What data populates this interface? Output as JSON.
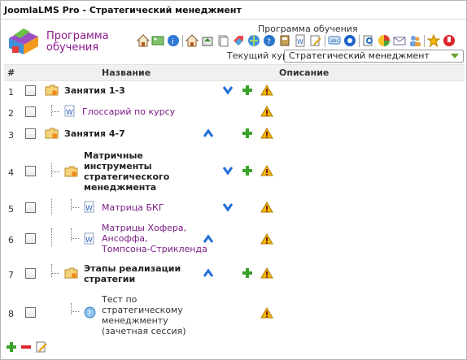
{
  "window": {
    "title": "JoomlaLMS Pro - Стратегический менеджмент"
  },
  "logo": {
    "line1": "Программа",
    "line2": "обучения"
  },
  "toolbar": {
    "caption": "Программа обучения",
    "course_label": "Текущий курс",
    "course_value": "Стратегический менеджмент"
  },
  "table": {
    "col_num": "#",
    "col_title": "Название",
    "col_desc": "Описание",
    "rows": [
      {
        "num": "1",
        "title": "Занятия 1-3"
      },
      {
        "num": "2",
        "title": "Глоссарий по курсу"
      },
      {
        "num": "3",
        "title": "Занятия 4-7"
      },
      {
        "num": "4",
        "title_lines": [
          "Матричные",
          "инструменты",
          "стратегического",
          "менеджмента"
        ]
      },
      {
        "num": "5",
        "title": "Матрица БКГ"
      },
      {
        "num": "6",
        "title_lines": [
          "Матрицы Хофера,",
          "Ансоффа,",
          "Томпсона-Стрикленда"
        ]
      },
      {
        "num": "7",
        "title_lines": [
          "Этапы реализации",
          "стратегии"
        ]
      },
      {
        "num": "8",
        "title_lines": [
          "Тест по",
          "стратегическому",
          "менеджменту",
          "(зачетная сессия)"
        ]
      }
    ]
  },
  "colors": {
    "link": "#7a1d85",
    "blue_arrow": "#1e6fd9",
    "green_plus": "#3aa12a",
    "warning": "#f2b705"
  }
}
